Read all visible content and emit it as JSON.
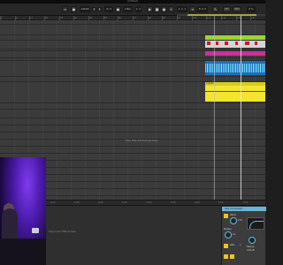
{
  "window": {
    "title": "[Untitled]"
  },
  "controls": {
    "buttons": [
      {
        "name": "link-button",
        "glyph": "∞"
      },
      {
        "name": "tap-button",
        "glyph": "●"
      },
      {
        "name": "tempo-field",
        "glyph": "120.00"
      },
      {
        "name": "nudge-down-button",
        "glyph": "‖"
      },
      {
        "name": "nudge-up-button",
        "glyph": "‖"
      },
      {
        "name": "signature-field",
        "glyph": "4 / 4"
      },
      {
        "name": "metronome-button",
        "glyph": "●"
      },
      {
        "name": "quantize-field",
        "glyph": "1 Bar"
      },
      {
        "name": "position-field",
        "glyph": "1. 1. 1"
      },
      {
        "name": "play-button",
        "glyph": "▶"
      },
      {
        "name": "stop-button",
        "glyph": "■"
      },
      {
        "name": "record-button",
        "glyph": "●"
      },
      {
        "name": "overdub-button",
        "glyph": "+"
      },
      {
        "name": "loop-start-field",
        "glyph": "1. 1. 1"
      },
      {
        "name": "punch-in-button",
        "glyph": "⇥"
      },
      {
        "name": "loop-length-field",
        "glyph": "8. 0. 0"
      },
      {
        "name": "draw-mode-button",
        "glyph": "✎"
      },
      {
        "name": "key-map-button",
        "glyph": "KEY"
      },
      {
        "name": "midi-map-button",
        "glyph": "MIDI"
      },
      {
        "name": "cpu-meter",
        "glyph": "6 %"
      }
    ]
  },
  "ruler": {
    "labels": [
      "1",
      "9",
      "17",
      "25",
      "33",
      "41",
      "49",
      "57",
      "65",
      "73",
      "81",
      "89",
      "97",
      "105",
      "113",
      "121",
      "129",
      "137"
    ]
  },
  "bottom_ruler": {
    "labels": [
      "0:00",
      "0:30",
      "1:00",
      "1:30",
      "2:00",
      "2:30",
      "3:00",
      "3:30",
      "4:00",
      "4:30",
      "5:00"
    ]
  },
  "arrangement": {
    "hint": "Drop Files and Devices Here",
    "clips": {
      "yellow_label": "3-Audio"
    }
  },
  "detail": {
    "hint": "Drop Audio Effects Here"
  },
  "device": {
    "title": "Glue Compressor",
    "readouts": [
      "Attack",
      "0.01",
      "Release",
      "0.1",
      "Ratio",
      "2",
      "Makeup",
      "0.00 dB"
    ]
  },
  "colors": {
    "green": "#9fd13b",
    "red": "#d11a1a",
    "pink": "#d02f9a",
    "blue": "#1f6fb3",
    "yellow": "#f1e530",
    "device_header": "#6db3d6"
  }
}
